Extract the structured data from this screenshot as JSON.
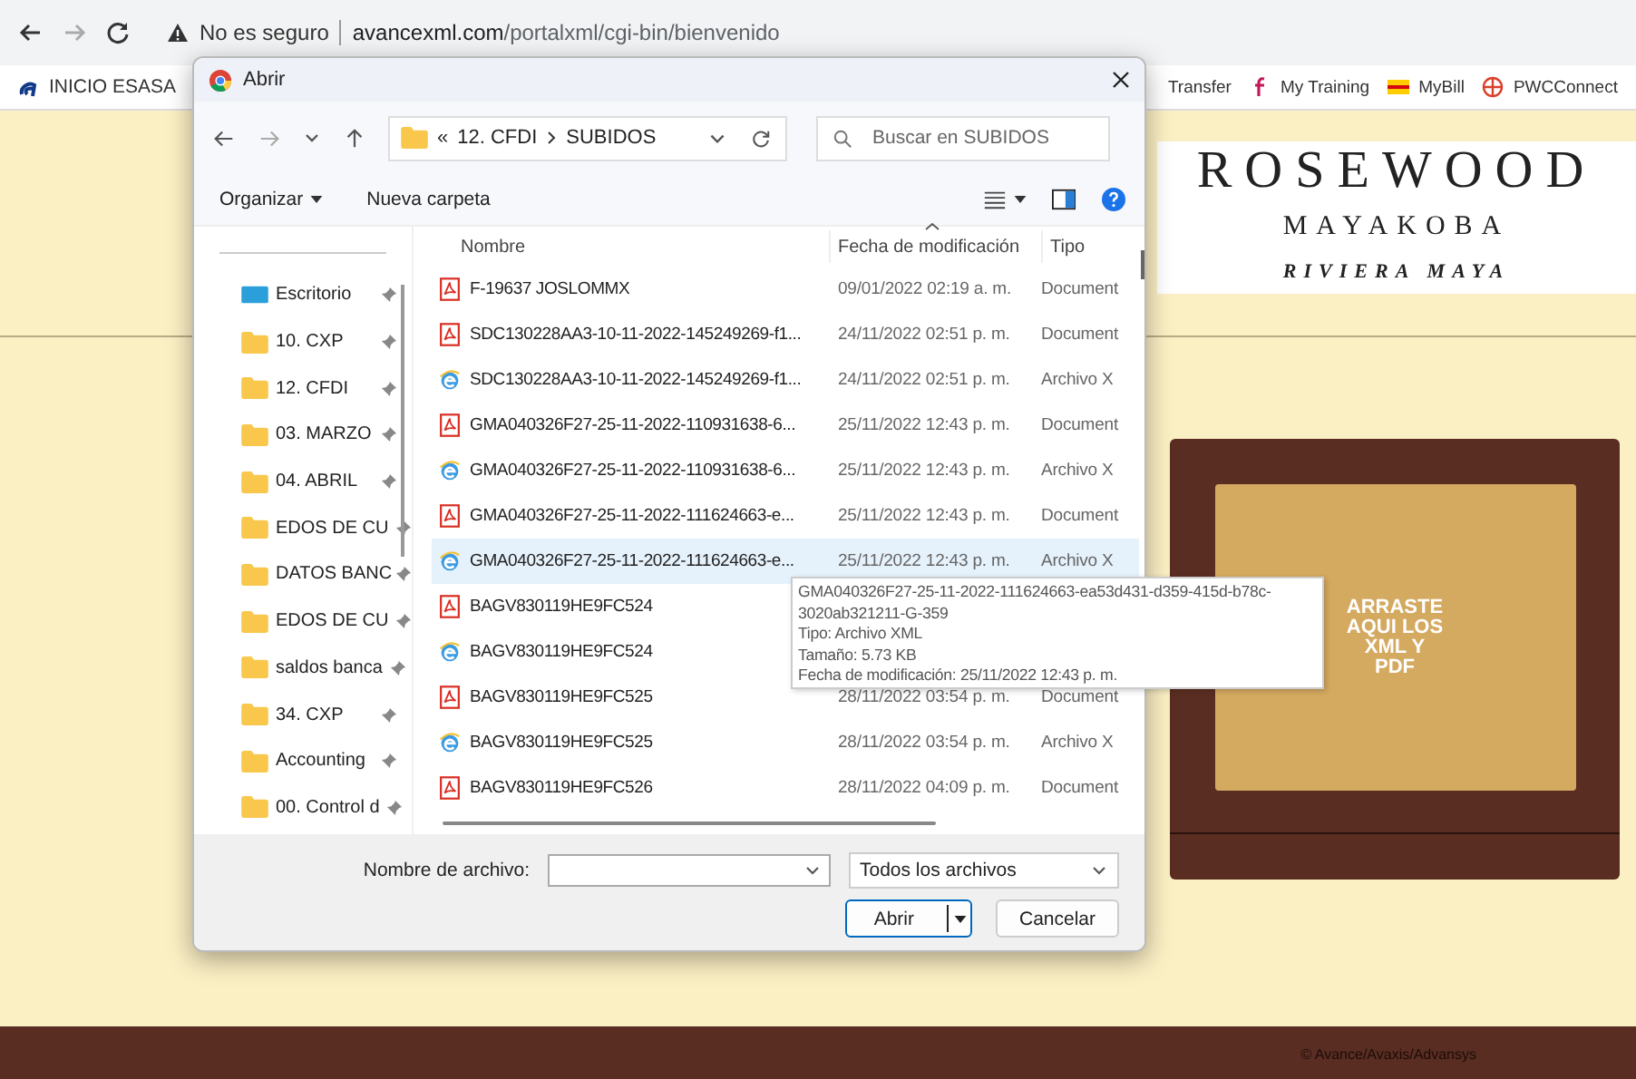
{
  "browser": {
    "security": "No es seguro",
    "url_host": "avancexml.com",
    "url_path": "/portalxml/cgi-bin/bienvenido"
  },
  "bookmarks_left": [
    {
      "label": "INICIO ESASA"
    }
  ],
  "bookmarks_right": [
    {
      "label": "Transfer",
      "kind": "plain"
    },
    {
      "label": "My Training",
      "kind": "f"
    },
    {
      "label": "MyBill",
      "kind": "dhl"
    },
    {
      "label": "PWCConnect",
      "kind": "globe"
    }
  ],
  "page": {
    "logo": {
      "name": "ROSEWOOD",
      "place": "MAYAKOBA",
      "region": "RIVIERA MAYA"
    },
    "dropzone": {
      "label": "ARRASTE\nAQUI LOS\nXML Y\nPDF"
    },
    "footer": "© Avance/Avaxis/Advansys"
  },
  "dialog": {
    "title": "Abrir",
    "breadcrumb": {
      "overflow": "«",
      "parts": [
        "12. CFDI",
        "SUBIDOS"
      ]
    },
    "search": {
      "placeholder": "Buscar en SUBIDOS"
    },
    "toolbar": {
      "organize": "Organizar",
      "new_folder": "Nueva carpeta"
    },
    "sidebar": [
      {
        "label": "Escritorio",
        "kind": "desktop",
        "pinned": true
      },
      {
        "label": "10. CXP",
        "kind": "folder",
        "pinned": true
      },
      {
        "label": "12. CFDI",
        "kind": "folder",
        "pinned": true
      },
      {
        "label": "03. MARZO",
        "kind": "folder",
        "pinned": true
      },
      {
        "label": "04. ABRIL",
        "kind": "folder",
        "pinned": true
      },
      {
        "label": "EDOS DE CU",
        "kind": "folder",
        "pinned": true
      },
      {
        "label": "DATOS BANC",
        "kind": "folder",
        "pinned": true
      },
      {
        "label": "EDOS DE CU",
        "kind": "folder",
        "pinned": true
      },
      {
        "label": "saldos banca",
        "kind": "folder",
        "pinned": true
      },
      {
        "label": "34. CXP",
        "kind": "folder",
        "pinned": true
      },
      {
        "label": "Accounting",
        "kind": "folder",
        "pinned": true
      },
      {
        "label": "00. Control d",
        "kind": "folder",
        "pinned": true
      }
    ],
    "columns": [
      {
        "label": "Nombre",
        "sorted": false
      },
      {
        "label": "Fecha de modificación",
        "sorted": true
      },
      {
        "label": "Tipo",
        "sorted": false
      }
    ],
    "files": [
      {
        "name": "F-19637 JOSLOMMX",
        "kind": "pdf",
        "date": "09/01/2022 02:19 a. m.",
        "type": "Document",
        "selected": false
      },
      {
        "name": "SDC130228AA3-10-11-2022-145249269-f1...",
        "kind": "pdf",
        "date": "24/11/2022 02:51 p. m.",
        "type": "Document",
        "selected": false
      },
      {
        "name": "SDC130228AA3-10-11-2022-145249269-f1...",
        "kind": "xml",
        "date": "24/11/2022 02:51 p. m.",
        "type": "Archivo X",
        "selected": false
      },
      {
        "name": "GMA040326F27-25-11-2022-110931638-6...",
        "kind": "pdf",
        "date": "25/11/2022 12:43 p. m.",
        "type": "Document",
        "selected": false
      },
      {
        "name": "GMA040326F27-25-11-2022-110931638-6...",
        "kind": "xml",
        "date": "25/11/2022 12:43 p. m.",
        "type": "Archivo X",
        "selected": false
      },
      {
        "name": "GMA040326F27-25-11-2022-111624663-e...",
        "kind": "pdf",
        "date": "25/11/2022 12:43 p. m.",
        "type": "Document",
        "selected": false
      },
      {
        "name": "GMA040326F27-25-11-2022-111624663-e...",
        "kind": "xml",
        "date": "25/11/2022 12:43 p. m.",
        "type": "Archivo X",
        "selected": true
      },
      {
        "name": "BAGV830119HE9FC524",
        "kind": "pdf",
        "selected": false
      },
      {
        "name": "BAGV830119HE9FC524",
        "kind": "xml",
        "selected": false
      },
      {
        "name": "BAGV830119HE9FC525",
        "kind": "pdf",
        "date": "28/11/2022 03:54 p. m.",
        "type": "Document",
        "selected": false
      },
      {
        "name": "BAGV830119HE9FC525",
        "kind": "xml",
        "date": "28/11/2022 03:54 p. m.",
        "type": "Archivo X",
        "selected": false
      },
      {
        "name": "BAGV830119HE9FC526",
        "kind": "pdf",
        "date": "28/11/2022 04:09 p. m.",
        "type": "Document",
        "selected": false
      }
    ],
    "tooltip": {
      "lines": [
        "GMA040326F27-25-11-2022-111624663-ea53d431-d359-415d-b78c-",
        "3020ab321211-G-359",
        "Tipo: Archivo XML",
        "Tamaño: 5.73 KB",
        "Fecha de modificación: 25/11/2022 12:43 p. m."
      ]
    },
    "filename_label": "Nombre de archivo:",
    "filter": "Todos los archivos",
    "buttons": [
      {
        "label": "Abrir",
        "kind": "split"
      },
      {
        "label": "Cancelar",
        "kind": "plain"
      }
    ]
  }
}
